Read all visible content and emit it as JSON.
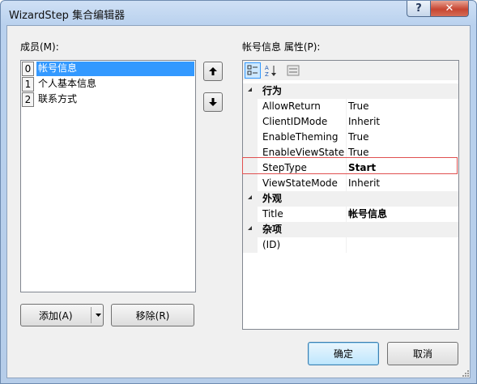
{
  "window": {
    "title": "WizardStep 集合编辑器"
  },
  "titlebar": {
    "help_label": "?",
    "close_label": "✕"
  },
  "members": {
    "label": "成员(M):",
    "items": [
      {
        "index": "0",
        "text": "帐号信息",
        "selected": true
      },
      {
        "index": "1",
        "text": "个人基本信息",
        "selected": false
      },
      {
        "index": "2",
        "text": "联系方式",
        "selected": false
      }
    ],
    "move_up": "🡑",
    "move_down": "🡓",
    "add_label": "添加(A)",
    "remove_label": "移除(R)"
  },
  "properties": {
    "label": "帐号信息 属性(P):",
    "toolbar": [
      "categorized-icon",
      "alphabetical-icon",
      "property-pages-icon"
    ],
    "categories": [
      {
        "name": "行为",
        "rows": [
          {
            "name": "AllowReturn",
            "value": "True",
            "bold": false
          },
          {
            "name": "ClientIDMode",
            "value": "Inherit",
            "bold": false
          },
          {
            "name": "EnableTheming",
            "value": "True",
            "bold": false
          },
          {
            "name": "EnableViewState",
            "value": "True",
            "bold": false
          },
          {
            "name": "StepType",
            "value": "Start",
            "bold": true
          },
          {
            "name": "ViewStateMode",
            "value": "Inherit",
            "bold": false
          }
        ]
      },
      {
        "name": "外观",
        "rows": [
          {
            "name": "Title",
            "value": "帐号信息",
            "bold": true
          }
        ]
      },
      {
        "name": "杂项",
        "rows": [
          {
            "name": "(ID)",
            "value": "",
            "bold": false
          }
        ]
      }
    ]
  },
  "footer": {
    "ok_label": "确定",
    "cancel_label": "取消"
  }
}
